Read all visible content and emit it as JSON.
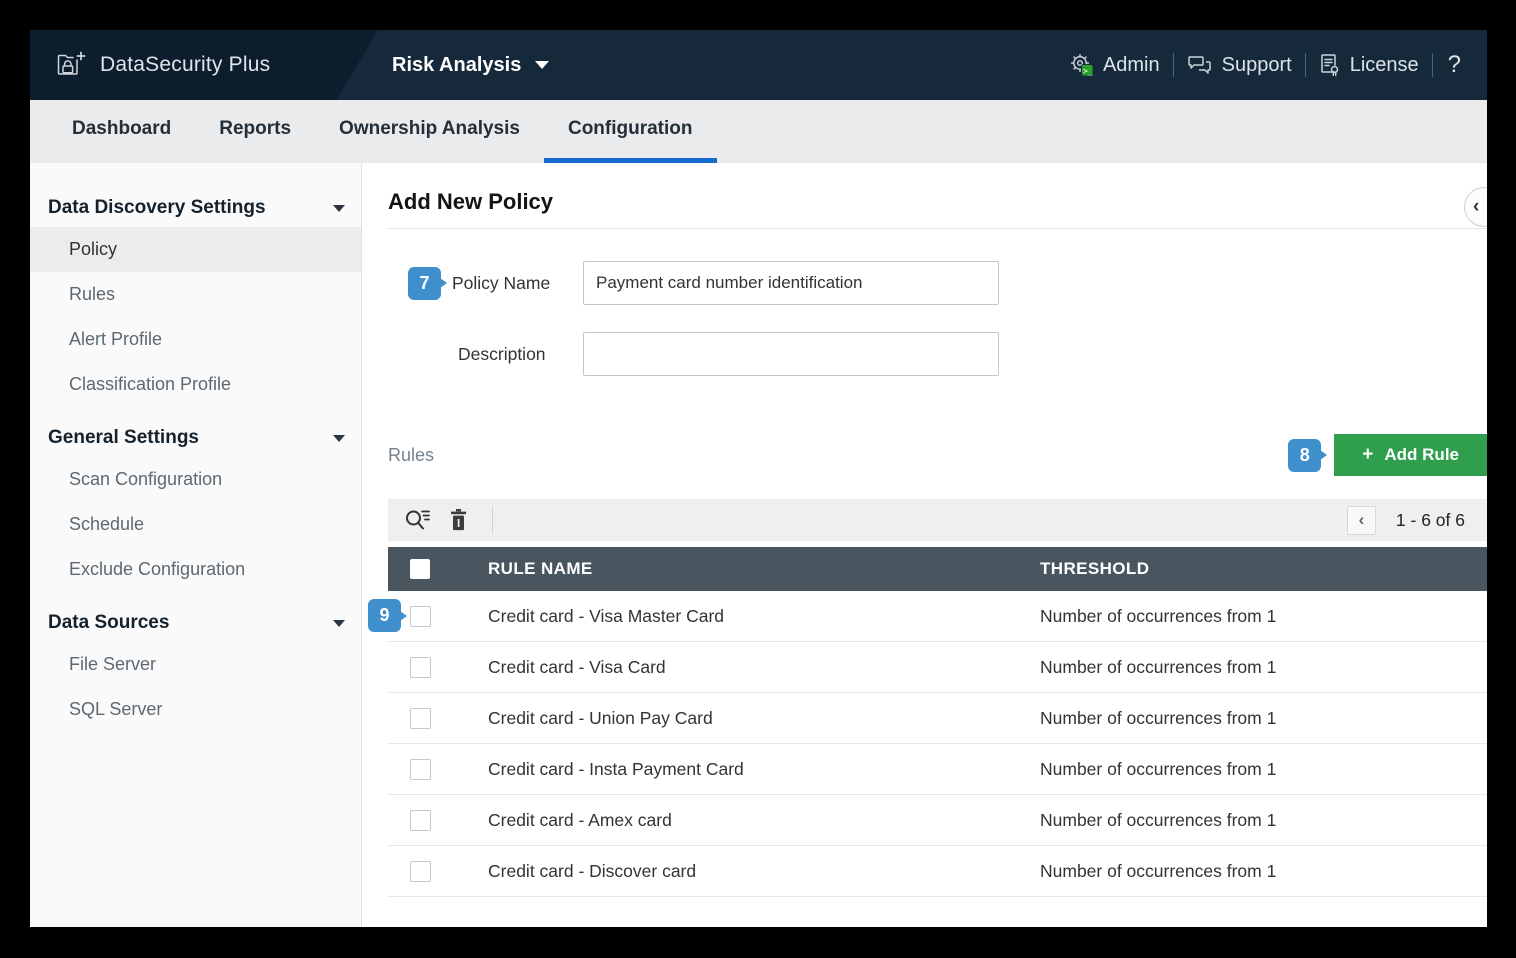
{
  "header": {
    "app_name": "DataSecurity Plus",
    "module": "Risk Analysis",
    "menu": {
      "admin": "Admin",
      "support": "Support",
      "license": "License",
      "help": "?"
    }
  },
  "nav": {
    "tabs": [
      {
        "label": "Dashboard",
        "active": false
      },
      {
        "label": "Reports",
        "active": false
      },
      {
        "label": "Ownership Analysis",
        "active": false
      },
      {
        "label": "Configuration",
        "active": true
      }
    ]
  },
  "sidebar": {
    "groups": [
      {
        "label": "Data Discovery Settings",
        "items": [
          {
            "label": "Policy",
            "selected": true
          },
          {
            "label": "Rules",
            "selected": false
          },
          {
            "label": "Alert Profile",
            "selected": false
          },
          {
            "label": "Classification Profile",
            "selected": false
          }
        ]
      },
      {
        "label": "General Settings",
        "items": [
          {
            "label": "Scan Configuration",
            "selected": false
          },
          {
            "label": "Schedule",
            "selected": false
          },
          {
            "label": "Exclude Configuration",
            "selected": false
          }
        ]
      },
      {
        "label": "Data Sources",
        "items": [
          {
            "label": "File Server",
            "selected": false
          },
          {
            "label": "SQL Server",
            "selected": false
          }
        ]
      }
    ]
  },
  "main": {
    "title": "Add New Policy",
    "back_icon": "‹",
    "callouts": {
      "policy_name": "7",
      "add_rule": "8",
      "first_rule": "9"
    },
    "form": {
      "policy_name_label": "Policy Name",
      "policy_name_value": "Payment card number identification",
      "description_label": "Description",
      "description_value": ""
    },
    "rules": {
      "label": "Rules",
      "add_button_icon": "+",
      "add_button": "Add Rule"
    },
    "pagination": {
      "prev": "‹",
      "range": "1 - 6 of 6"
    },
    "table": {
      "columns": {
        "name": "RULE NAME",
        "threshold": "THRESHOLD"
      },
      "rows": [
        {
          "name": "Credit card - Visa Master Card",
          "threshold": "Number of occurrences from 1"
        },
        {
          "name": "Credit card - Visa Card",
          "threshold": "Number of occurrences from 1"
        },
        {
          "name": "Credit card - Union Pay Card",
          "threshold": "Number of occurrences from 1"
        },
        {
          "name": "Credit card - Insta Payment Card",
          "threshold": "Number of occurrences from 1"
        },
        {
          "name": "Credit card - Amex card",
          "threshold": "Number of occurrences from 1"
        },
        {
          "name": "Credit card - Discover card",
          "threshold": "Number of occurrences from 1"
        }
      ]
    }
  },
  "colors": {
    "header_bg": "#15293b",
    "logo_bg": "#0c1e2d",
    "nav_bg": "#e9ebed",
    "active_tab_underline": "#1569cf",
    "table_header_bg": "#49555f",
    "add_rule_green": "#2f9e4d",
    "callout_blue": "#3f8fcd"
  }
}
